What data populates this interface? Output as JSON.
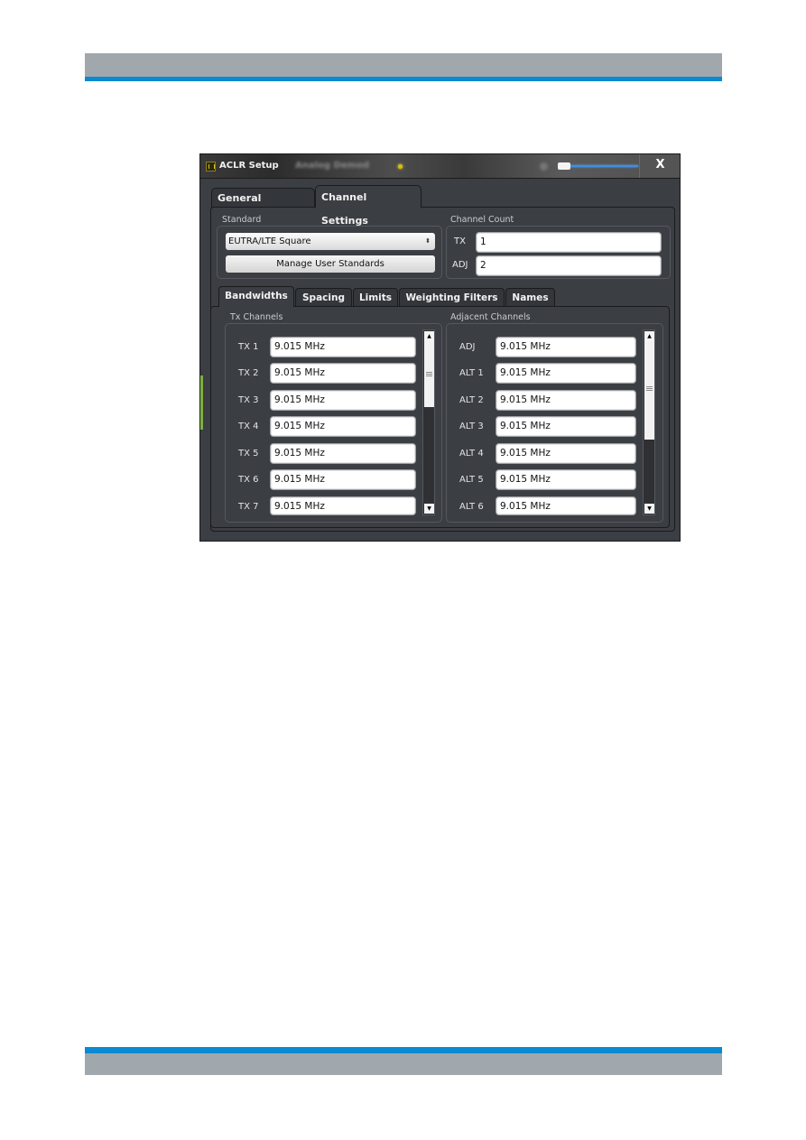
{
  "page": {
    "header_color": "#a1a8ad",
    "accent_color": "#0b8ad0"
  },
  "dialog": {
    "title": "ACLR Setup",
    "blurred_title": "Analog Demod",
    "close_label": "X",
    "tabs": [
      {
        "label": "General Settings",
        "active": false
      },
      {
        "label": "Channel Settings",
        "active": true
      }
    ],
    "standard": {
      "section_label": "Standard",
      "selected": "EUTRA/LTE Square",
      "manage_button": "Manage User Standards"
    },
    "channel_count": {
      "section_label": "Channel Count",
      "tx_label": "TX",
      "tx_value": "1",
      "adj_label": "ADJ",
      "adj_value": "2"
    },
    "subtabs": [
      {
        "label": "Bandwidths",
        "active": true
      },
      {
        "label": "Spacing",
        "active": false
      },
      {
        "label": "Limits",
        "active": false
      },
      {
        "label": "Weighting Filters",
        "active": false
      },
      {
        "label": "Names",
        "active": false
      }
    ],
    "tx_channels": {
      "section_label": "Tx Channels",
      "rows": [
        {
          "label": "TX 1",
          "value": "9.015 MHz"
        },
        {
          "label": "TX 2",
          "value": "9.015 MHz"
        },
        {
          "label": "TX 3",
          "value": "9.015 MHz"
        },
        {
          "label": "TX 4",
          "value": "9.015 MHz"
        },
        {
          "label": "TX 5",
          "value": "9.015 MHz"
        },
        {
          "label": "TX 6",
          "value": "9.015 MHz"
        },
        {
          "label": "TX 7",
          "value": "9.015 MHz"
        }
      ]
    },
    "adjacent_channels": {
      "section_label": "Adjacent Channels",
      "rows": [
        {
          "label": "ADJ",
          "value": "9.015 MHz"
        },
        {
          "label": "ALT 1",
          "value": "9.015 MHz"
        },
        {
          "label": "ALT 2",
          "value": "9.015 MHz"
        },
        {
          "label": "ALT 3",
          "value": "9.015 MHz"
        },
        {
          "label": "ALT 4",
          "value": "9.015 MHz"
        },
        {
          "label": "ALT 5",
          "value": "9.015 MHz"
        },
        {
          "label": "ALT 6",
          "value": "9.015 MHz"
        }
      ]
    },
    "icons": {
      "scroll_up": "▲",
      "scroll_down": "▼",
      "select_arrows": "⬍"
    }
  }
}
